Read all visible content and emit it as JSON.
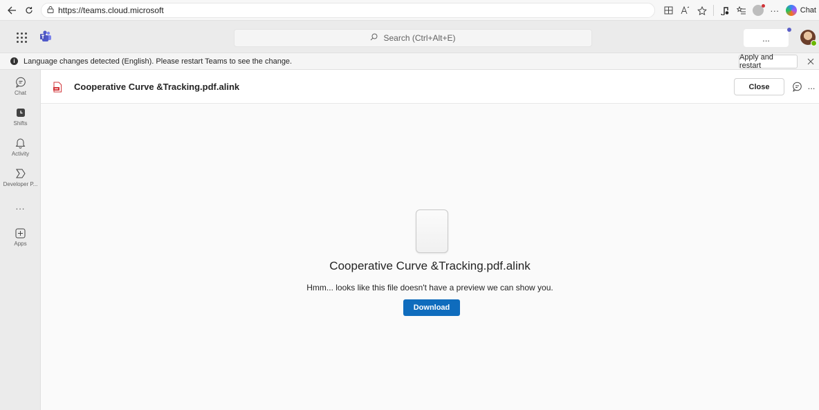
{
  "browser": {
    "url": "https://teams.cloud.microsoft",
    "copilot_label": "Chat"
  },
  "teams": {
    "search_placeholder": "Search (Ctrl+Alt+E)",
    "more_label": "..."
  },
  "banner": {
    "message": "Language changes detected (English). Please restart Teams to see the change.",
    "apply_label": "Apply and restart"
  },
  "rail": {
    "items": [
      {
        "label": "Chat",
        "icon": "chat-icon"
      },
      {
        "label": "Shifts",
        "icon": "shifts-icon"
      },
      {
        "label": "Activity",
        "icon": "bell-icon"
      },
      {
        "label": "Developer P...",
        "icon": "developer-portal-icon"
      },
      {
        "label": "Apps",
        "icon": "plus-square-icon"
      }
    ],
    "more_label": "..."
  },
  "file": {
    "title": "Cooperative Curve &Tracking.pdf.alink",
    "close_label": "Close",
    "more_label": "..."
  },
  "preview": {
    "title": "Cooperative Curve &Tracking.pdf.alink",
    "message": "Hmm... looks like this file doesn't have a preview we can show you.",
    "download_label": "Download"
  },
  "colors": {
    "accent": "#0f6cbd",
    "teams_purple": "#5b5fc7",
    "status_available": "#6bb700",
    "pdf_red": "#d13438"
  }
}
